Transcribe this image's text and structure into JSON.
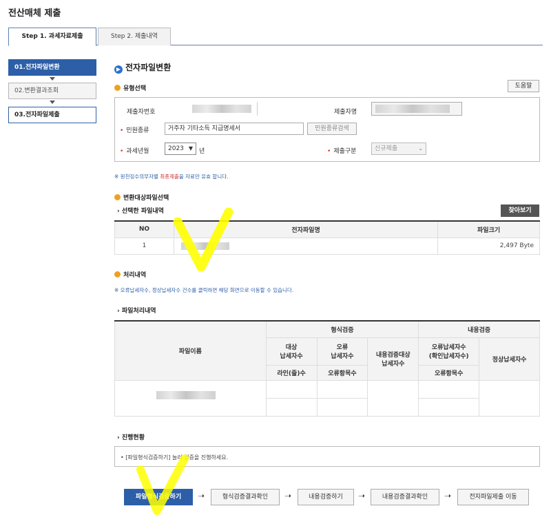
{
  "page": {
    "title": "전산매체 제출"
  },
  "tabs": [
    {
      "label": "Step 1. 과세자료제출"
    },
    {
      "label": "Step 2. 제출내역"
    }
  ],
  "sidebar": {
    "items": [
      {
        "label": "01.전자파일변환"
      },
      {
        "label": "02.변환결과조회"
      },
      {
        "label": "03.전자파일제출"
      }
    ]
  },
  "main": {
    "title": "전자파일변환",
    "type_select": {
      "title": "유형선택",
      "help_label": "도움말",
      "submitter_no_label": "제출자번호",
      "submitter_name_label": "제출자명",
      "form_type_label": "민원종류",
      "form_type_value": "거주자 기타소득 지급명세서",
      "form_search_label": "민원종류검색",
      "tax_year_label": "과세년월",
      "tax_year_value": "2023",
      "year_suffix": "년",
      "submit_type_label": "제출구분",
      "submit_type_value": "신규제출"
    },
    "note1_prefix": "※ 원천징수의무자별 ",
    "note1_red": "최종제출",
    "note1_suffix": "을 자료만 유효 합니다.",
    "file_select": {
      "title": "변환대상파일선택",
      "selected_label": "선택한 파일내역",
      "browse_label": "찾아보기",
      "headers": {
        "no": "NO",
        "name": "전자파일명",
        "size": "파일크기"
      },
      "rows": [
        {
          "no": "1",
          "size": "2,497 Byte"
        }
      ]
    },
    "process": {
      "title": "처리내역",
      "note": "※ 오류납세자수, 정상납세자수 건수를 클릭하면 해당 화면으로 이동할 수 있습니다.",
      "detail_label": "파일처리내역",
      "headers": {
        "file_name": "파일이름",
        "format_check": "형식검증",
        "content_check": "내용검증",
        "target_taxpayers": "대상\n납세자수",
        "error_taxpayers": "오류\n납세자수",
        "content_target": "내용검증대상\n납세자수",
        "error_taxpayers_confirm": "오류납세자수\n(확인납세자수)",
        "normal_taxpayers": "정상납세자수",
        "lines": "라인(줄)수",
        "error_items": "오류항목수",
        "error_items2": "오류항목수"
      }
    },
    "progress": {
      "title": "진행현황",
      "message": "• [파일형식검증하기] 눌러 검증을 진행하세요."
    },
    "flow_buttons": [
      {
        "label": "파일형식검증하기"
      },
      {
        "label": "형식검증결과확인"
      },
      {
        "label": "내용검증하기"
      },
      {
        "label": "내용검증결과확인"
      },
      {
        "label": "전자파일제출 이동"
      }
    ]
  },
  "colors": {
    "accent": "#2c5fa8",
    "required": "#e03030",
    "annotation": "#ffff00"
  }
}
